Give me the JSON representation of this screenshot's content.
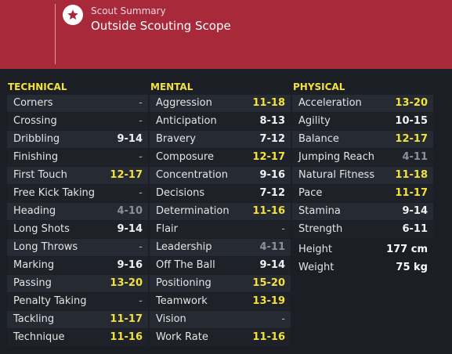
{
  "header": {
    "subtitle": "Scout Summary",
    "title": "Outside Scouting Scope",
    "icon": "star-icon"
  },
  "columns": [
    {
      "heading": "TECHNICAL",
      "rows": [
        {
          "label": "Corners",
          "value": "-",
          "tier": "dash"
        },
        {
          "label": "Crossing",
          "value": "-",
          "tier": "dash"
        },
        {
          "label": "Dribbling",
          "value": "9-14",
          "tier": "white"
        },
        {
          "label": "Finishing",
          "value": "-",
          "tier": "dash"
        },
        {
          "label": "First Touch",
          "value": "12-17",
          "tier": "yellow"
        },
        {
          "label": "Free Kick Taking",
          "value": "-",
          "tier": "dash"
        },
        {
          "label": "Heading",
          "value": "4-10",
          "tier": "grey"
        },
        {
          "label": "Long Shots",
          "value": "9-14",
          "tier": "white"
        },
        {
          "label": "Long Throws",
          "value": "-",
          "tier": "dash"
        },
        {
          "label": "Marking",
          "value": "9-16",
          "tier": "white"
        },
        {
          "label": "Passing",
          "value": "13-20",
          "tier": "yellow"
        },
        {
          "label": "Penalty Taking",
          "value": "-",
          "tier": "dash"
        },
        {
          "label": "Tackling",
          "value": "11-17",
          "tier": "yellow"
        },
        {
          "label": "Technique",
          "value": "11-16",
          "tier": "yellow"
        }
      ]
    },
    {
      "heading": "MENTAL",
      "rows": [
        {
          "label": "Aggression",
          "value": "11-18",
          "tier": "yellow"
        },
        {
          "label": "Anticipation",
          "value": "8-13",
          "tier": "white"
        },
        {
          "label": "Bravery",
          "value": "7-12",
          "tier": "white"
        },
        {
          "label": "Composure",
          "value": "12-17",
          "tier": "yellow"
        },
        {
          "label": "Concentration",
          "value": "9-16",
          "tier": "white"
        },
        {
          "label": "Decisions",
          "value": "7-12",
          "tier": "white"
        },
        {
          "label": "Determination",
          "value": "11-16",
          "tier": "yellow"
        },
        {
          "label": "Flair",
          "value": "-",
          "tier": "dash"
        },
        {
          "label": "Leadership",
          "value": "4-11",
          "tier": "grey"
        },
        {
          "label": "Off The Ball",
          "value": "9-14",
          "tier": "white"
        },
        {
          "label": "Positioning",
          "value": "15-20",
          "tier": "yellow"
        },
        {
          "label": "Teamwork",
          "value": "13-19",
          "tier": "yellow"
        },
        {
          "label": "Vision",
          "value": "-",
          "tier": "dash"
        },
        {
          "label": "Work Rate",
          "value": "11-16",
          "tier": "yellow"
        }
      ]
    },
    {
      "heading": "PHYSICAL",
      "rows": [
        {
          "label": "Acceleration",
          "value": "13-20",
          "tier": "yellow"
        },
        {
          "label": "Agility",
          "value": "10-15",
          "tier": "white"
        },
        {
          "label": "Balance",
          "value": "12-17",
          "tier": "yellow"
        },
        {
          "label": "Jumping Reach",
          "value": "4-11",
          "tier": "grey"
        },
        {
          "label": "Natural Fitness",
          "value": "11-18",
          "tier": "yellow"
        },
        {
          "label": "Pace",
          "value": "11-17",
          "tier": "yellow"
        },
        {
          "label": "Stamina",
          "value": "9-14",
          "tier": "white"
        },
        {
          "label": "Strength",
          "value": "6-11",
          "tier": "white"
        }
      ],
      "extra": [
        {
          "label": "Height",
          "value": "177 cm"
        },
        {
          "label": "Weight",
          "value": "75 kg"
        }
      ]
    }
  ],
  "colors": {
    "header_bg": "#a7293a",
    "background": "#1b1e25",
    "heading": "#f3e13c",
    "good_value": "#f3e13c",
    "poor_value": "#8d9098"
  }
}
